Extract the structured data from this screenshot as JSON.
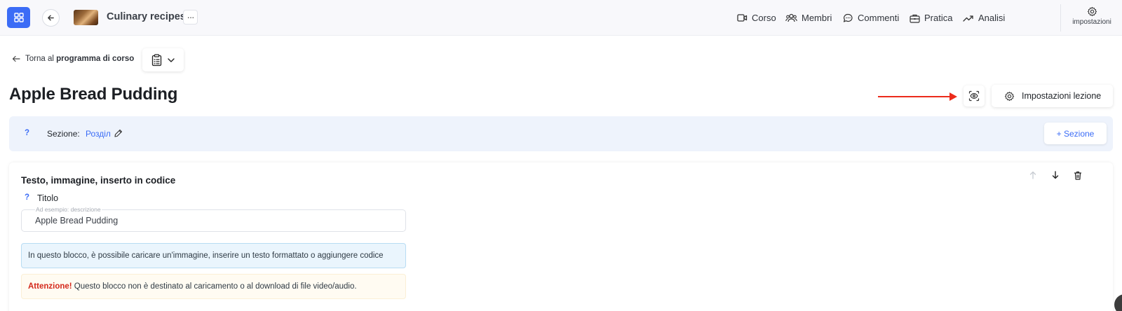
{
  "topbar": {
    "course_title": "Culinary recipes",
    "more_label": "···",
    "nav": [
      {
        "label": "Corso",
        "icon": "video-icon"
      },
      {
        "label": "Membri",
        "icon": "users-icon"
      },
      {
        "label": "Commenti",
        "icon": "comment-icon"
      },
      {
        "label": "Pratica",
        "icon": "briefcase-icon"
      },
      {
        "label": "Analisi",
        "icon": "trend-icon"
      }
    ],
    "settings_label": "impostazioni"
  },
  "breadcrumb": {
    "prefix": "Torna al",
    "target": "programma di corso"
  },
  "lesson": {
    "title": "Apple Bread Pudding",
    "settings_button": "Impostazioni lezione"
  },
  "section": {
    "help": "?",
    "label": "Sezione:",
    "value": "Розділ",
    "add_button": "+ Sezione"
  },
  "block": {
    "title": "Testo, immagine, inserto in codice",
    "field_help": "?",
    "field_label": "Titolo",
    "field_placeholder": "Ad esempio: descrizione",
    "field_value": "Apple Bread Pudding",
    "info_text": "In questo blocco, è possibile caricare un'immagine, inserire un testo formattato o aggiungere codice",
    "warning_strong": "Attenzione!",
    "warning_text": " Questo blocco non è destinato al caricamento o al download di file video/audio."
  },
  "colors": {
    "accent": "#3b6cf6",
    "annotation_arrow": "#ec2b1b",
    "warning": "#d4281b"
  }
}
